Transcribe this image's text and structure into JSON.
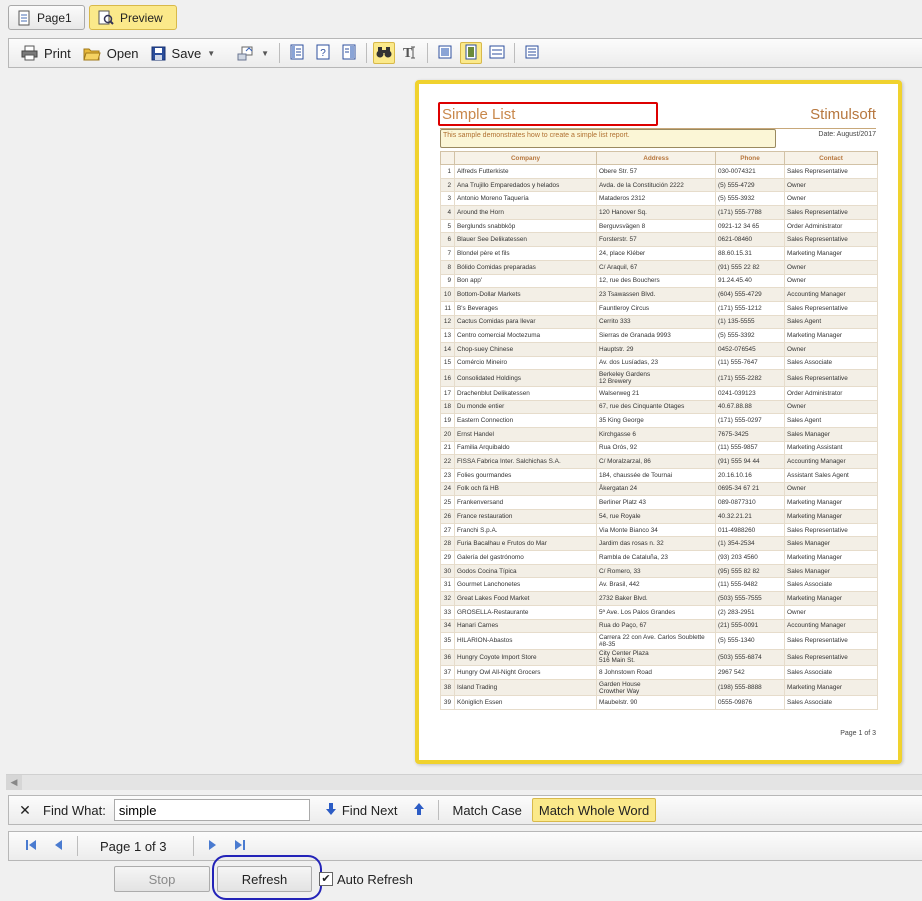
{
  "tabs": [
    {
      "label": "Page1",
      "icon": "page-icon"
    },
    {
      "label": "Preview",
      "icon": "preview-icon"
    }
  ],
  "toolbar": {
    "print_label": "Print",
    "open_label": "Open",
    "save_label": "Save"
  },
  "report": {
    "title": "Simple List",
    "brand": "Stimulsoft",
    "description": "This sample demonstrates how to create a simple list report.",
    "date": "Date: August/2017",
    "columns": [
      "Company",
      "Address",
      "Phone",
      "Contact"
    ],
    "rows": [
      [
        "1",
        "Alfreds Futterkiste",
        "Obere Str. 57",
        "030-0074321",
        "Sales Representative"
      ],
      [
        "2",
        "Ana Trujillo Emparedados y helados",
        "Avda. de la Constitución 2222",
        "(5) 555-4729",
        "Owner"
      ],
      [
        "3",
        "Antonio Moreno Taquería",
        "Mataderos  2312",
        "(5) 555-3932",
        "Owner"
      ],
      [
        "4",
        "Around the Horn",
        "120 Hanover Sq.",
        "(171) 555-7788",
        "Sales Representative"
      ],
      [
        "5",
        "Berglunds snabbköp",
        "Berguvsvägen  8",
        "0921-12 34 65",
        "Order Administrator"
      ],
      [
        "6",
        "Blauer See Delikatessen",
        "Forsterstr. 57",
        "0621-08460",
        "Sales Representative"
      ],
      [
        "7",
        "Blondel père et fils",
        "24, place Kléber",
        "88.60.15.31",
        "Marketing Manager"
      ],
      [
        "8",
        "Bólido Comidas preparadas",
        "C/ Araquil, 67",
        "(91) 555 22 82",
        "Owner"
      ],
      [
        "9",
        "Bon app'",
        "12, rue des Bouchers",
        "91.24.45.40",
        "Owner"
      ],
      [
        "10",
        "Bottom-Dollar Markets",
        "23 Tsawassen Blvd.",
        "(604) 555-4729",
        "Accounting Manager"
      ],
      [
        "11",
        "B's Beverages",
        "Fauntleroy Circus",
        "(171) 555-1212",
        "Sales Representative"
      ],
      [
        "12",
        "Cactus Comidas para llevar",
        "Cerrito 333",
        "(1) 135-5555",
        "Sales Agent"
      ],
      [
        "13",
        "Centro comercial Moctezuma",
        "Sierras de Granada 9993",
        "(5) 555-3392",
        "Marketing Manager"
      ],
      [
        "14",
        "Chop-suey Chinese",
        "Hauptstr. 29",
        "0452-076545",
        "Owner"
      ],
      [
        "15",
        "Comércio Mineiro",
        "Av. dos Lusíadas, 23",
        "(11) 555-7647",
        "Sales Associate"
      ],
      [
        "16",
        "Consolidated Holdings",
        "Berkeley Gardens\n12  Brewery",
        "(171) 555-2282",
        "Sales Representative"
      ],
      [
        "17",
        "Drachenblut Delikatessen",
        "Walserweg 21",
        "0241-039123",
        "Order Administrator"
      ],
      [
        "18",
        "Du monde entier",
        "67, rue des Cinquante Otages",
        "40.67.88.88",
        "Owner"
      ],
      [
        "19",
        "Eastern Connection",
        "35 King George",
        "(171) 555-0297",
        "Sales Agent"
      ],
      [
        "20",
        "Ernst Handel",
        "Kirchgasse 6",
        "7675-3425",
        "Sales Manager"
      ],
      [
        "21",
        "Familia Arquibaldo",
        "Rua Orós, 92",
        "(11) 555-9857",
        "Marketing Assistant"
      ],
      [
        "22",
        "FISSA Fabrica Inter. Salchichas S.A.",
        "C/ Moralzarzal, 86",
        "(91) 555 94 44",
        "Accounting Manager"
      ],
      [
        "23",
        "Folies gourmandes",
        "184, chaussée de Tournai",
        "20.16.10.16",
        "Assistant Sales Agent"
      ],
      [
        "24",
        "Folk och fä HB",
        "Åkergatan 24",
        "0695-34 67 21",
        "Owner"
      ],
      [
        "25",
        "Frankenversand",
        "Berliner Platz 43",
        "089-0877310",
        "Marketing Manager"
      ],
      [
        "26",
        "France restauration",
        "54, rue Royale",
        "40.32.21.21",
        "Marketing Manager"
      ],
      [
        "27",
        "Franchi S.p.A.",
        "Via Monte Bianco 34",
        "011-4988260",
        "Sales Representative"
      ],
      [
        "28",
        "Furia Bacalhau e Frutos do Mar",
        "Jardim das rosas n. 32",
        "(1) 354-2534",
        "Sales Manager"
      ],
      [
        "29",
        "Galería del gastrónomo",
        "Rambla de Cataluña, 23",
        "(93) 203 4560",
        "Marketing Manager"
      ],
      [
        "30",
        "Godos Cocina Típica",
        "C/ Romero, 33",
        "(95) 555 82 82",
        "Sales Manager"
      ],
      [
        "31",
        "Gourmet Lanchonetes",
        "Av. Brasil, 442",
        "(11) 555-9482",
        "Sales Associate"
      ],
      [
        "32",
        "Great Lakes Food Market",
        "2732 Baker Blvd.",
        "(503) 555-7555",
        "Marketing Manager"
      ],
      [
        "33",
        "GROSELLA-Restaurante",
        "5ª Ave. Los Palos Grandes",
        "(2) 283-2951",
        "Owner"
      ],
      [
        "34",
        "Hanari Carnes",
        "Rua do Paço, 67",
        "(21) 555-0091",
        "Accounting Manager"
      ],
      [
        "35",
        "HILARION-Abastos",
        "Carrera 22 con Ave. Carlos Soublette\n#8-35",
        "(5) 555-1340",
        "Sales Representative"
      ],
      [
        "36",
        "Hungry Coyote Import Store",
        "City Center Plaza\n516 Main St.",
        "(503) 555-6874",
        "Sales Representative"
      ],
      [
        "37",
        "Hungry Owl All-Night Grocers",
        "8 Johnstown Road",
        "2967 542",
        "Sales Associate"
      ],
      [
        "38",
        "Island Trading",
        "Garden House\nCrowther Way",
        "(198) 555-8888",
        "Marketing Manager"
      ],
      [
        "39",
        "Königlich Essen",
        "Maubelstr. 90",
        "0555-09876",
        "Sales Associate"
      ]
    ],
    "tall_rows": [
      15,
      34,
      35,
      37
    ],
    "footer": "Page 1 of 3"
  },
  "find": {
    "label": "Find What:",
    "value": "simple",
    "find_next_label": "Find Next",
    "match_case_label": "Match Case",
    "match_whole_word_label": "Match Whole Word"
  },
  "nav": {
    "page_text": "Page 1 of 3"
  },
  "bottom": {
    "stop_label": "Stop",
    "refresh_label": "Refresh",
    "auto_refresh_label": "Auto Refresh",
    "auto_refresh_checked": "✔"
  },
  "colors": {
    "accent_yellow": "#fbe98a",
    "report_gold": "#f0d22e",
    "title_orange": "#c8874a",
    "highlight_red": "#dd0000",
    "circle_blue": "#2323b8"
  }
}
